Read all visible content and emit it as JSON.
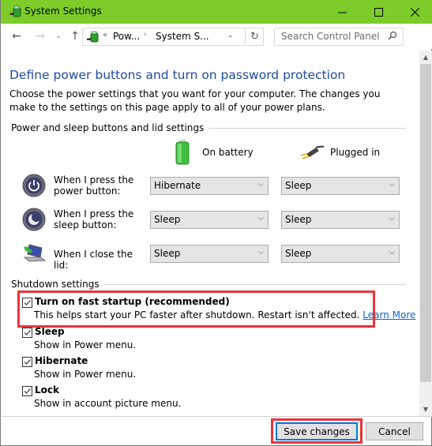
{
  "window": {
    "title": "System Settings",
    "controls": {
      "minimize": "minimize",
      "maximize": "maximize",
      "close": "close"
    },
    "accent_color": "#7dcc29"
  },
  "navigation": {
    "breadcrumb_prefix": "«",
    "breadcrumbs": [
      "Pow...",
      "System S..."
    ],
    "breadcrumb_separator": "›",
    "search_placeholder": "Search Control Panel"
  },
  "page": {
    "heading": "Define power buttons and turn on password protection",
    "description": "Choose the power settings that you want for your computer. The changes you make to the settings on this page apply to all of your power plans.",
    "power_section": {
      "label": "Power and sleep buttons and lid settings",
      "columns": [
        {
          "label": "On battery",
          "icon": "battery-icon"
        },
        {
          "label": "Plugged in",
          "icon": "plug-icon"
        }
      ],
      "rows": [
        {
          "label": "When I press the power button:",
          "icon": "power-button-icon",
          "on_battery": "Hibernate",
          "plugged_in": "Sleep"
        },
        {
          "label": "When I press the sleep button:",
          "icon": "sleep-button-icon",
          "on_battery": "Sleep",
          "plugged_in": "Sleep"
        },
        {
          "label": "When I close the lid:",
          "icon": "laptop-lid-icon",
          "on_battery": "Sleep",
          "plugged_in": "Sleep"
        }
      ]
    },
    "shutdown_section": {
      "label": "Shutdown settings",
      "items": [
        {
          "title": "Turn on fast startup (recommended)",
          "description": "This helps start your PC faster after shutdown. Restart isn't affected.",
          "link": "Learn More",
          "checked": true
        },
        {
          "title": "Sleep",
          "description": "Show in Power menu.",
          "checked": true
        },
        {
          "title": "Hibernate",
          "description": "Show in Power menu.",
          "checked": true
        },
        {
          "title": "Lock",
          "description": "Show in account picture menu.",
          "checked": true
        }
      ]
    }
  },
  "footer": {
    "save_label": "Save changes",
    "cancel_label": "Cancel"
  },
  "annotations": {
    "highlight_color": "#ec3339"
  }
}
